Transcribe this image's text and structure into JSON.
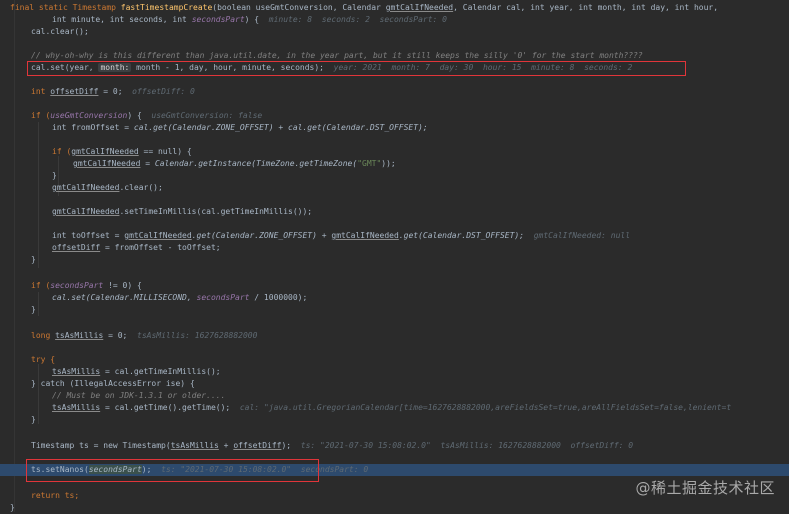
{
  "editor": {
    "lines": {
      "l01a": "final static Timestamp ",
      "l01b": "fastTimestampCreate",
      "l01c": "(boolean useGmtConversion, Calendar ",
      "l01d": "gmtCalIfNeeded",
      "l01e": ", Calendar cal, int year, int month, int day, int hour,",
      "l02a": "int minute, int seconds, int ",
      "l02b": "secondsPart",
      "l02c": ") {",
      "l02hint": "minute: 8  seconds: 2  secondsPart: 0",
      "l03": "cal.clear();",
      "l05": "// why-oh-why is this different than java.util.date, in the year part, but it still keeps the silly '0' for the start month????",
      "l06a": "cal.set(year, ",
      "l06badge": "month:",
      "l06b": " month - 1, day, hour, minute, seconds);",
      "l06hint": "year: 2021  month: 7  day: 30  hour: 15  minute: 8  seconds: 2",
      "l08a": "int ",
      "l08b": "offsetDiff",
      "l08c": " = 0;",
      "l08hint": "offsetDiff: 0",
      "l10a": "if (",
      "l10b": "useGmtConversion",
      "l10c": ") {",
      "l10hint": "useGmtConversion: false",
      "l11a": "int fromOffset = ",
      "l11b": "cal.get(Calendar.ZONE_OFFSET) + cal.get(Calendar.DST_OFFSET);",
      "l13a": "if (",
      "l13b": "gmtCalIfNeeded",
      "l13c": " == null) {",
      "l14a": "gmtCalIfNeeded",
      "l14b": " = Calendar.getInstance(TimeZone.getTimeZone(",
      "l14str": "\"GMT\"",
      "l14c": "));",
      "l15": "}",
      "l16a": "gmtCalIfNeeded",
      "l16b": ".clear();",
      "l18a": "gmtCalIfNeeded",
      "l18b": ".setTimeInMillis(cal.getTimeInMillis());",
      "l20a": "int toOffset = ",
      "l20b": "gmtCalIfNeeded",
      "l20c": ".get(Calendar.ZONE_OFFSET) + ",
      "l20d": "gmtCalIfNeeded",
      "l20e": ".get(Calendar.DST_OFFSET);",
      "l20hint": "gmtCalIfNeeded: null",
      "l21a": "offsetDiff",
      "l21b": " = fromOffset - toOffset;",
      "l22": "}",
      "l24a": "if (",
      "l24b": "secondsPart",
      "l24c": " != 0) {",
      "l25a": "cal.set(Calendar.MILLISECOND, ",
      "l25b": "secondsPart",
      "l25c": " / 1000000);",
      "l26": "}",
      "l28a": "long ",
      "l28b": "tsAsMillis",
      "l28c": " = 0;",
      "l28hint": "tsAsMillis: 1627628882000",
      "l30": "try {",
      "l31a": "tsAsMillis",
      "l31b": " = cal.getTimeInMillis();",
      "l32": "} catch (IllegalAccessError ise) {",
      "l33": "// Must be on JDK-1.3.1 or older....",
      "l34a": "tsAsMillis",
      "l34b": " = cal.getTime().getTime();",
      "l34hint": "cal: \"java.util.GregorianCalendar[time=1627628882000,areFieldsSet=true,areAllFieldsSet=false,lenient=t",
      "l35": "}",
      "l37a": "Timestamp ts = new Timestamp(",
      "l37b": "tsAsMillis",
      "l37c": " + ",
      "l37d": "offsetDiff",
      "l37e": ");",
      "l37hint": "ts: \"2021-07-30 15:08:02.0\"  tsAsMillis: 1627628882000  offsetDiff: 0",
      "l39a": "ts.setNanos(",
      "l39b": "secondsPart",
      "l39c": ");",
      "l39hint1": "ts: \"2021-07-30 15:08:02.0\"",
      "l39hint2": "secondsPart: 0",
      "l41": "return ts;",
      "l42": "}"
    }
  },
  "watermark": "@稀土掘金技术社区",
  "colors": {
    "background": "#2b2b2b",
    "keyword": "#cc7832",
    "method": "#ffc66d",
    "field": "#9876aa",
    "string": "#6a8759",
    "comment": "#808080",
    "highlight_line": "#2d4a6d",
    "annotation_box": "#e0353a"
  }
}
